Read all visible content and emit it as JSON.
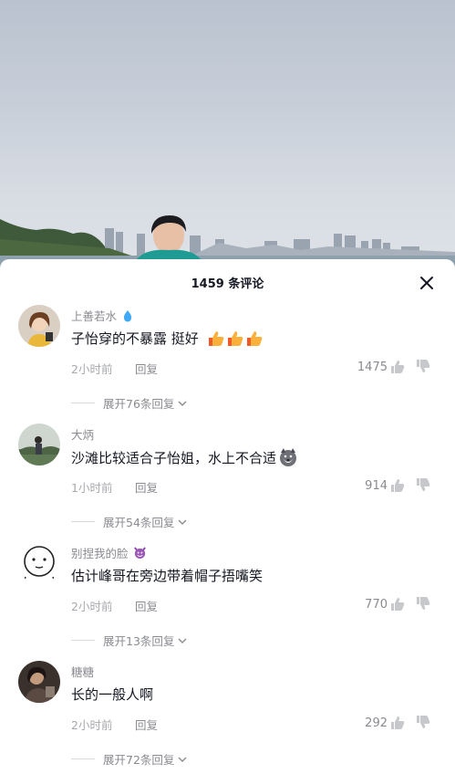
{
  "panel": {
    "title": "1459 条评论"
  },
  "comments": [
    {
      "username": "上善若水",
      "text": "子怡穿的不暴露 挺好",
      "time": "2小时前",
      "reply_label": "回复",
      "likes": "1475",
      "expand_label": "展开76条回复",
      "emojis": [
        "droplet-emoji",
        "thumbs-up-emoji",
        "thumbs-up-emoji",
        "thumbs-up-emoji"
      ]
    },
    {
      "username": "大炳",
      "text": "沙滩比较适合子怡姐，水上不合适",
      "time": "1小时前",
      "reply_label": "回复",
      "likes": "914",
      "expand_label": "展开54条回复",
      "emojis": [
        "husky-emoji"
      ]
    },
    {
      "username": "别捏我的脸",
      "text": "估计峰哥在旁边带着帽子捂嘴笑",
      "time": "2小时前",
      "reply_label": "回复",
      "likes": "770",
      "expand_label": "展开13条回复",
      "emojis": [
        "devil-emoji"
      ]
    },
    {
      "username": "糖糖",
      "text": "长的一般人啊",
      "time": "2小时前",
      "reply_label": "回复",
      "likes": "292",
      "expand_label": "展开72条回复",
      "emojis": []
    }
  ],
  "colors": {
    "primary_text": "#161823",
    "secondary_text": "#8a8b91",
    "background": "#ffffff"
  }
}
